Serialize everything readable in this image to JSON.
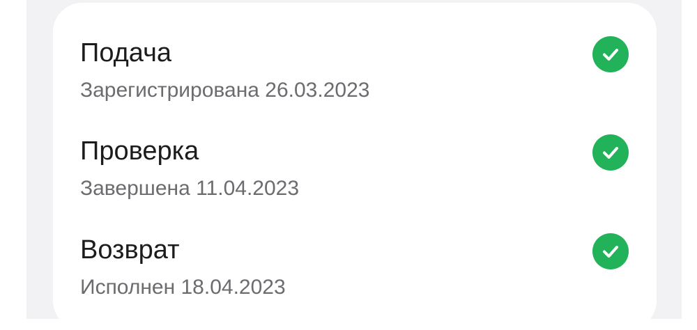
{
  "status_card": {
    "steps": [
      {
        "title": "Подача",
        "subtitle": "Зарегистрирована 26.03.2023",
        "status_icon": "check-circle-icon",
        "status_color": "#22b259"
      },
      {
        "title": "Проверка",
        "subtitle": "Завершена 11.04.2023",
        "status_icon": "check-circle-icon",
        "status_color": "#22b259"
      },
      {
        "title": "Возврат",
        "subtitle": "Исполнен 18.04.2023",
        "status_icon": "check-circle-icon",
        "status_color": "#22b259"
      }
    ]
  },
  "colors": {
    "background": "#f2f2f4",
    "card": "#ffffff",
    "title_text": "#1c1c1e",
    "subtitle_text": "#6b6b70",
    "success": "#22b259"
  }
}
